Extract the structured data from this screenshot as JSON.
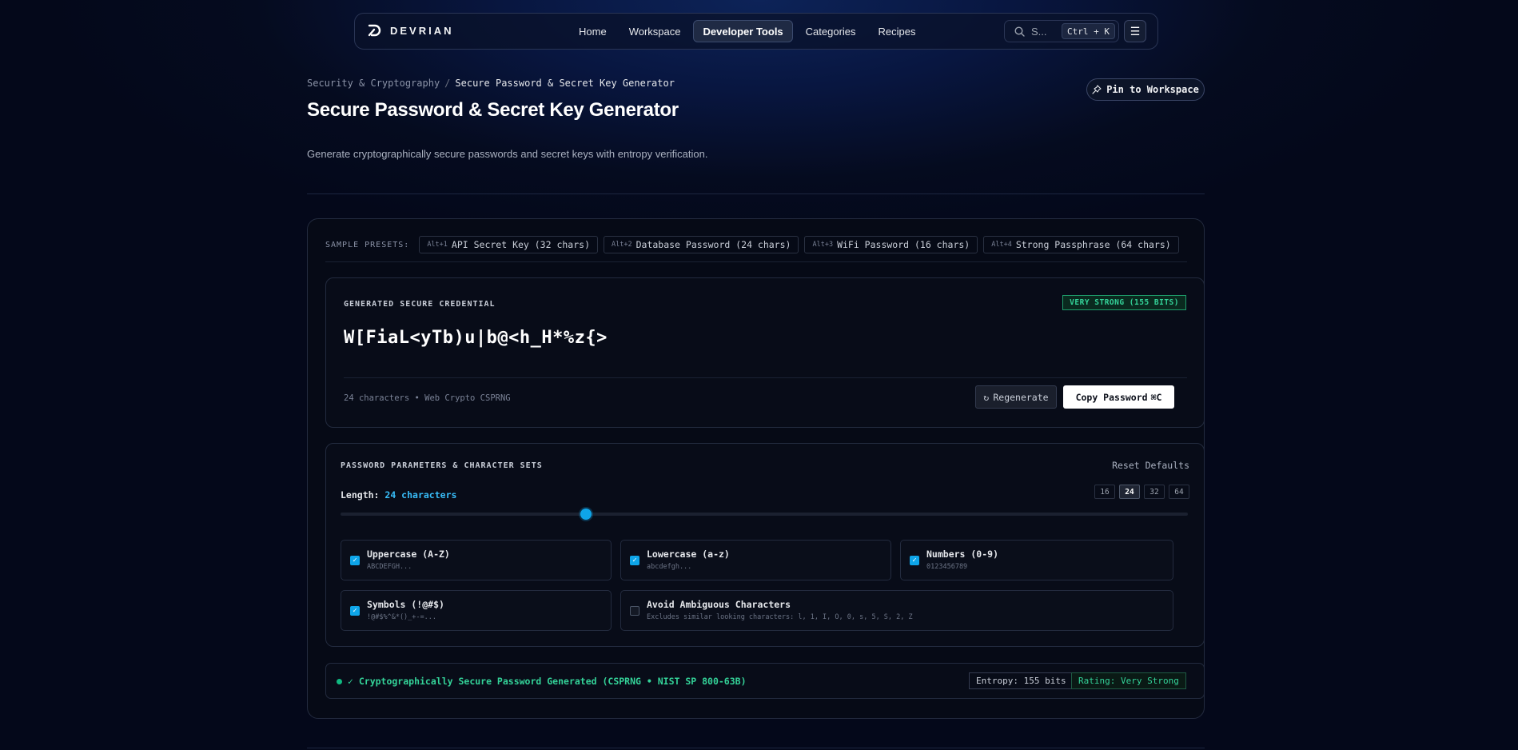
{
  "nav": {
    "brand": "DEVRIAN",
    "links": [
      "Home",
      "Workspace",
      "Developer Tools",
      "Categories",
      "Recipes"
    ],
    "active_link": "Developer Tools",
    "search_text": "S...",
    "search_shortcut": "Ctrl + K",
    "menu_icon": "hamburger-icon"
  },
  "header": {
    "breadcrumb_parent": "Security & Cryptography",
    "breadcrumb_sep": "/",
    "breadcrumb_current": "Secure Password & Secret Key Generator",
    "title": "Secure Password & Secret Key Generator",
    "description": "Generate cryptographically secure passwords and secret keys with entropy verification.",
    "pin_label": "Pin to Workspace"
  },
  "presets": {
    "label": "SAMPLE PRESETS:",
    "items": [
      {
        "key": "Alt+1",
        "label": "API Secret Key (32 chars)"
      },
      {
        "key": "Alt+2",
        "label": "Database Password (24 chars)"
      },
      {
        "key": "Alt+3",
        "label": "WiFi Password (16 chars)"
      },
      {
        "key": "Alt+4",
        "label": "Strong Passphrase (64 chars)"
      }
    ]
  },
  "credential": {
    "label": "GENERATED SECURE CREDENTIAL",
    "strength": "VERY STRONG (155 BITS)",
    "value": "W[FiaL<yTb)u|b@<h_H*%z{>",
    "meta": "24 characters • Web Crypto CSPRNG",
    "regenerate_label": "Regenerate",
    "copy_label": "Copy Password",
    "copy_shortcut": "⌘C"
  },
  "params": {
    "title": "PASSWORD PARAMETERS & CHARACTER SETS",
    "reset_label": "Reset Defaults",
    "length_label": "Length:",
    "length_value": "24 characters",
    "length_options": [
      "16",
      "24",
      "32",
      "64"
    ],
    "active_length": "24",
    "slider_fraction": 0.29,
    "options": [
      {
        "title": "Uppercase (A-Z)",
        "sub": "ABCDEFGH...",
        "checked": true
      },
      {
        "title": "Lowercase (a-z)",
        "sub": "abcdefgh...",
        "checked": true
      },
      {
        "title": "Numbers (0-9)",
        "sub": "0123456789",
        "checked": true
      },
      {
        "title": "Symbols (!@#$)",
        "sub": "!@#$%^&*()_+-=...",
        "checked": true
      },
      {
        "title": "Avoid Ambiguous Characters",
        "sub": "Excludes similar looking characters: l, 1, I, O, 0, s, 5, S, 2, Z",
        "checked": false
      }
    ]
  },
  "status": {
    "text": "✓ Cryptographically Secure Password Generated (CSPRNG • NIST SP 800-63B)",
    "entropy": "Entropy: 155 bits",
    "rating": "Rating: Very Strong"
  },
  "colors": {
    "accent": "#0ea5e9",
    "success": "#34d399",
    "background": "#050b1f"
  }
}
